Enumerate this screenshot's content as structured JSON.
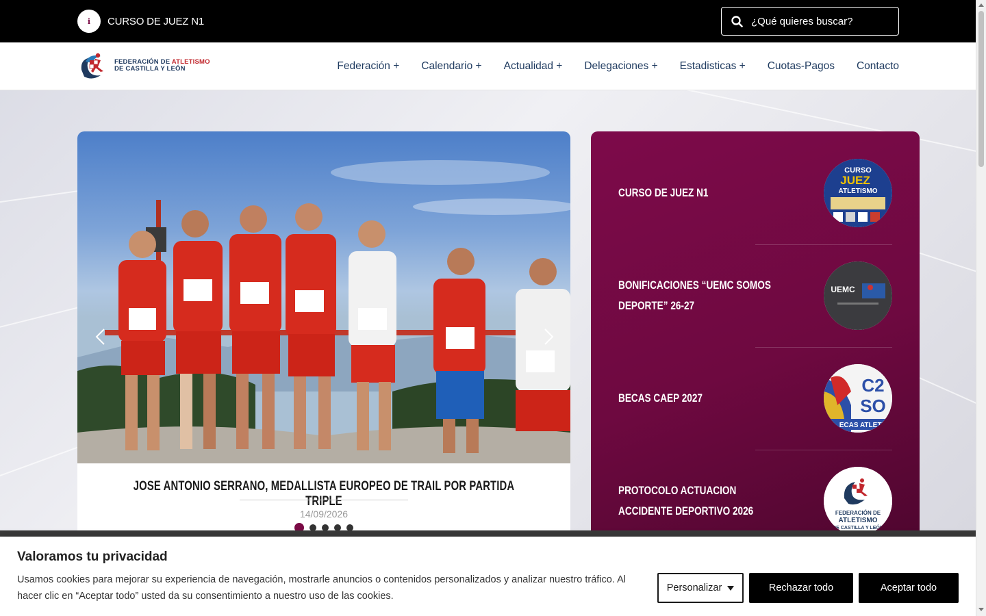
{
  "topbar": {
    "ticker_icon": "info-icon",
    "ticker_text": "CURSO DE JUEZ N1",
    "search_placeholder": "¿Qué quieres buscar?"
  },
  "logo": {
    "line1_a": "FEDERACIÓN DE ",
    "line1_b": "ATLETISMO",
    "line2": "DE CASTILLA Y LEÓN"
  },
  "nav": {
    "items": [
      "Federación +",
      "Calendario +",
      "Actualidad +",
      "Delegaciones +",
      "Estadisticas +",
      "Cuotas-Pagos",
      "Contacto"
    ]
  },
  "slider": {
    "title": "JOSE ANTONIO SERRANO, MEDALLISTA EUROPEO DE TRAIL POR PARTIDA TRIPLE",
    "date": "14/09/2026",
    "slide_count": 5,
    "active_slide": 1
  },
  "news": {
    "items": [
      {
        "title": "CURSO DE JUEZ N1",
        "thumb": "curso-juez-thumb"
      },
      {
        "title": "BONIFICACIONES “UEMC SOMOS DEPORTE” 26-27",
        "thumb": "uemc-thumb"
      },
      {
        "title": "BECAS CAEP 2027",
        "thumb": "becas-thumb"
      },
      {
        "title": "PROTOCOLO ACTUACION ACCIDENTE DEPORTIVO 2026",
        "thumb": "fed-logo-thumb"
      }
    ],
    "thumb_texts": {
      "curso_a": "CURSO",
      "curso_b": "JUEZ",
      "curso_c": "ATLETISMO",
      "uemc": "UEMC",
      "becas": "ECAS ATLETI",
      "fed_a": "FEDERACIÓN DE",
      "fed_b": "ATLETISMO",
      "fed_c": "DE CASTILLA Y LEÓN"
    }
  },
  "cookie": {
    "title": "Valoramos tu privacidad",
    "text": "Usamos cookies para mejorar su experiencia de navegación, mostrarle anuncios o contenidos personalizados y analizar nuestro tráfico. Al hacer clic en “Aceptar todo” usted da su consentimiento a nuestro uso de las cookies.",
    "customize_label": "Personalizar",
    "reject_label": "Rechazar todo",
    "accept_label": "Aceptar todo"
  },
  "colors": {
    "brand": "#7a0a45",
    "nav_text": "#1e3a5f",
    "topbar_bg": "#000000"
  }
}
